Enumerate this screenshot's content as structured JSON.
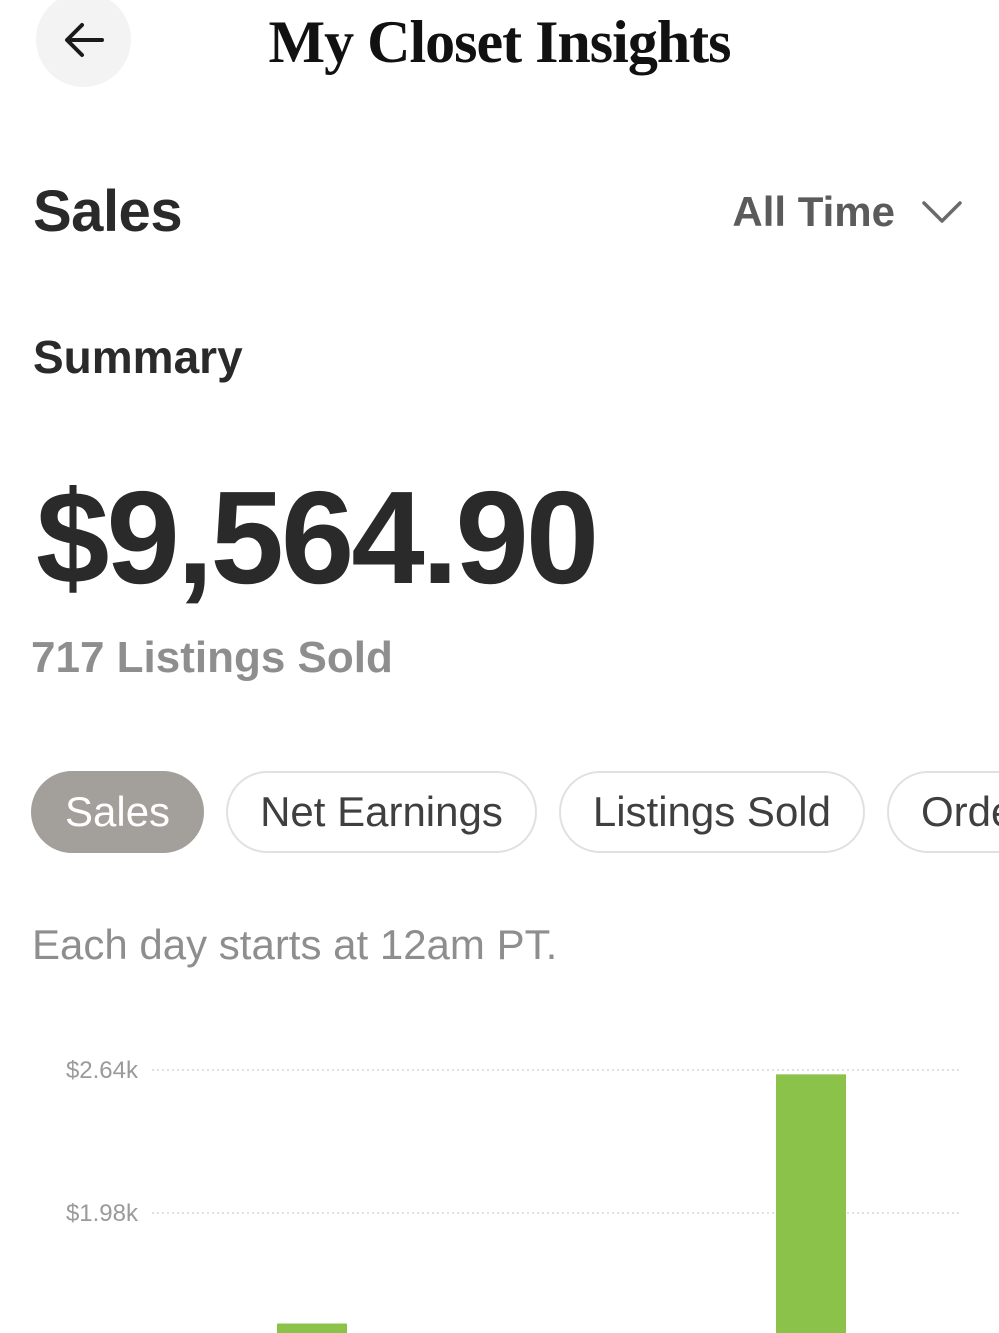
{
  "header": {
    "title": "My Closet Insights",
    "back_icon": "arrow-left-icon"
  },
  "section": {
    "title": "Sales",
    "range": {
      "selected": "All Time",
      "icon": "chevron-down-icon"
    }
  },
  "summary": {
    "label": "Summary",
    "amount": "$9,564.90",
    "listings_sold": "717 Listings Sold"
  },
  "tabs": [
    {
      "label": "Sales",
      "active": true
    },
    {
      "label": "Net Earnings",
      "active": false
    },
    {
      "label": "Listings Sold",
      "active": false
    },
    {
      "label": "Orders",
      "active": false
    }
  ],
  "note": "Each day starts at 12am PT.",
  "colors": {
    "bar": "#8bc34a",
    "active_tab": "#a39f9b",
    "gridline": "#d6d6d6",
    "axis_text": "#9a9a9a"
  },
  "chart_data": {
    "type": "bar",
    "title": "",
    "xlabel": "",
    "ylabel": "",
    "y_tick_labels": [
      "$2.64k",
      "$1.98k"
    ],
    "y_ticks": [
      2640,
      1980
    ],
    "values": [
      1470,
      2620
    ],
    "grid": true
  }
}
